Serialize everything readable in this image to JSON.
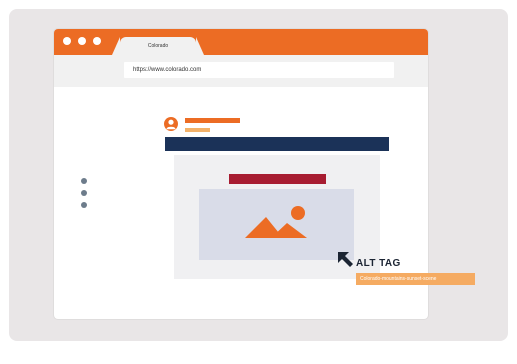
{
  "browser": {
    "tab_title": "Colorado",
    "address_url": "https://www.colorado.com"
  },
  "annotation": {
    "label": "ALT TAG",
    "alt_text": "Colorado-mountains-sunset-scene"
  },
  "icons": {
    "avatar": "user-avatar-icon",
    "image": "image-placeholder-icon",
    "pointer": "arrow-pointer-icon",
    "menu": "vertical-dots-icon"
  },
  "colors": {
    "orange": "#ec6c24",
    "light_orange": "#f5ab62",
    "navy": "#1b3258",
    "crimson": "#a71c31",
    "placeholder": "#d9dce8",
    "menu_dots": "#6d7c8b",
    "panel_bg": "#e9e6e7"
  }
}
